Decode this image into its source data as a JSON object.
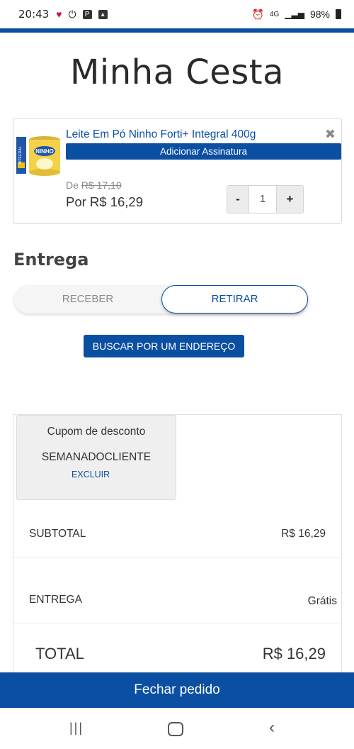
{
  "status_bar": {
    "time": "20:43",
    "battery_text": "98%",
    "network_text": "4G",
    "icons": [
      "heart-icon",
      "download-icon",
      "parking-icon",
      "image-icon",
      "alarm-icon",
      "signal-icon",
      "battery-icon"
    ]
  },
  "page": {
    "title": "Minha Cesta"
  },
  "product": {
    "name": "Leite Em Pó Ninho Forti+ Integral 400g",
    "subscribe_label": "Adicionar Assinatura",
    "old_price_prefix": "De",
    "old_price": "R$ 17,10",
    "new_price": "Por R$ 16,29",
    "quantity": "1",
    "minus_label": "-",
    "plus_label": "+",
    "remove_icon": "close-icon"
  },
  "delivery": {
    "title": "Entrega",
    "option_receive": "RECEBER",
    "option_pickup": "RETIRAR",
    "selected": "RETIRAR",
    "address_button": "BUSCAR POR UM ENDEREÇO"
  },
  "summary": {
    "coupon_title": "Cupom de desconto",
    "coupon_code": "SEMANADOCLIENTE",
    "coupon_remove": "EXCLUIR",
    "subtotal_label": "SUBTOTAL",
    "subtotal_value": "R$ 16,29",
    "delivery_label": "ENTREGA",
    "delivery_value": "Grátis",
    "total_label": "TOTAL",
    "total_value": "R$ 16,29"
  },
  "checkout": {
    "label": "Fechar pedido"
  },
  "colors": {
    "brand": "#0b4fa3",
    "muted": "#8a8a8a"
  }
}
